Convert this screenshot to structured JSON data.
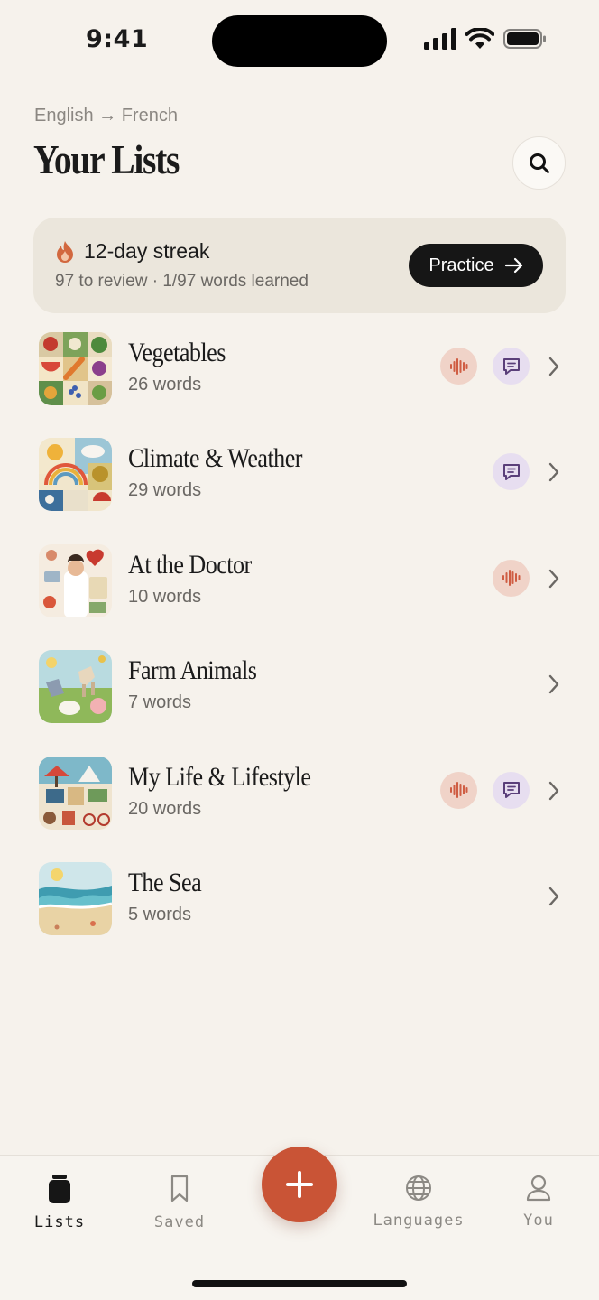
{
  "status_bar": {
    "time": "9:41"
  },
  "header": {
    "language_pair": "English → French",
    "title": "Your Lists"
  },
  "streak": {
    "title": "12-day streak",
    "subtitle": "97 to review · 1/97 words learned",
    "practice_label": "Practice"
  },
  "lists": [
    {
      "title": "Vegetables",
      "count": "26 words",
      "audio": true,
      "chat": true
    },
    {
      "title": "Climate & Weather",
      "count": "29 words",
      "audio": false,
      "chat": true
    },
    {
      "title": "At the Doctor",
      "count": "10 words",
      "audio": true,
      "chat": false
    },
    {
      "title": "Farm Animals",
      "count": "7 words",
      "audio": false,
      "chat": false
    },
    {
      "title": "My Life & Lifestyle",
      "count": "20 words",
      "audio": true,
      "chat": true
    },
    {
      "title": "The Sea",
      "count": "5 words",
      "audio": false,
      "chat": false
    }
  ],
  "tab_bar": {
    "tabs": [
      {
        "label": "Lists",
        "icon": "jar-icon",
        "active": true
      },
      {
        "label": "Saved",
        "icon": "bookmark-icon",
        "active": false
      },
      {
        "label": "Languages",
        "icon": "globe-icon",
        "active": false
      },
      {
        "label": "You",
        "icon": "person-icon",
        "active": false
      }
    ],
    "add_icon": "plus-icon"
  },
  "colors": {
    "background": "#f6f2ec",
    "accent": "#c95436",
    "streak_card": "#ebe6dc",
    "audio_badge": "#f0d3c8",
    "chat_badge": "#e7def0"
  }
}
